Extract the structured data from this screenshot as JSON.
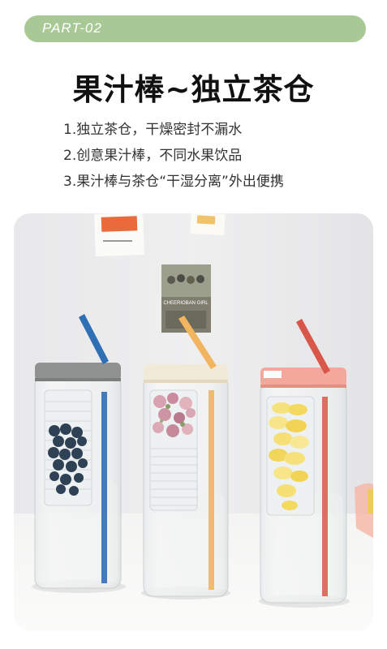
{
  "header": {
    "part_label": "PART-02",
    "accent_color": "#a8c896"
  },
  "headline": "果汁棒~独立茶仓",
  "features": [
    "1.独立茶仓，干燥密封不漏水",
    "2.创意果汁棒，不同水果饮品",
    "3.果汁棒与茶仓“干湿分离”外出便携"
  ],
  "photo": {
    "poster_text": "CHEERIOBAN GIRL",
    "bottles": [
      {
        "lid_color": "#8f9291",
        "straw_color": "#2f6fb3",
        "infuser_content": "blueberries"
      },
      {
        "lid_color": "#f2ead8",
        "straw_color": "#f1b560",
        "infuser_content": "rose-petals"
      },
      {
        "lid_color": "#f4a79b",
        "straw_color": "#d9574a",
        "infuser_content": "lemon-slices"
      }
    ]
  }
}
